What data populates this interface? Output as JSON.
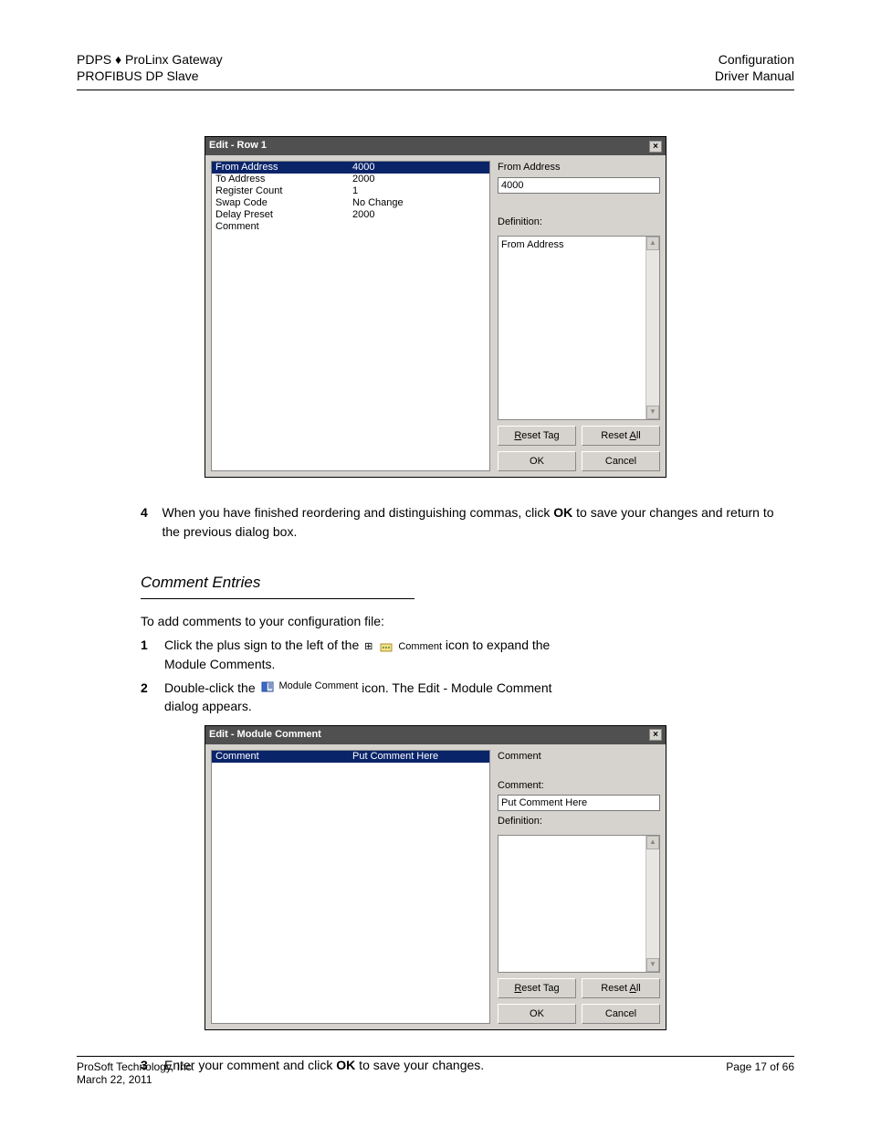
{
  "header": {
    "left_line1": "PDPS ♦ ProLinx Gateway",
    "left_line2": "PROFIBUS DP Slave",
    "right_line1": "Configuration",
    "right_line2": "Driver Manual"
  },
  "dialog1": {
    "title": "Edit - Row 1",
    "rows": [
      {
        "k": "From Address",
        "v": "4000",
        "sel": true
      },
      {
        "k": "To Address",
        "v": "2000",
        "sel": false
      },
      {
        "k": "Register Count",
        "v": "1",
        "sel": false
      },
      {
        "k": "Swap Code",
        "v": "No Change",
        "sel": false
      },
      {
        "k": "Delay Preset",
        "v": "2000",
        "sel": false
      },
      {
        "k": "Comment",
        "v": "",
        "sel": false
      }
    ],
    "field_label": "From Address",
    "field_value": "4000",
    "definition_label": "Definition:",
    "definition_text": "From Address",
    "reset_tag": "Reset Tag",
    "reset_all": "Reset All",
    "ok": "OK",
    "cancel": "Cancel"
  },
  "para_after_dlg1": {
    "n4": "4",
    "t4a": "When you have finished reordering and distinguishing commas, click ",
    "t4_bold": "OK",
    "t4b": " to save your changes and return to the previous dialog box."
  },
  "comment_section": {
    "title": "Comment Entries",
    "intro": "To add comments to your configuration file:",
    "n1": "1",
    "t1a": "Click the plus sign to the left of the ",
    "icon1_label": "Comment",
    "t1b": " icon to expand the",
    "t1c": "Module Comments.",
    "n2": "2",
    "t2a": "Double-click the ",
    "icon2_label": "Module Comment",
    "t2b": " icon. The Edit - Module Comment",
    "t2c": "dialog appears."
  },
  "dialog2": {
    "title": "Edit - Module Comment",
    "rows": [
      {
        "k": "Comment",
        "v": "Put Comment Here",
        "sel": true
      }
    ],
    "field_label": "Comment",
    "comment_label": "Comment:",
    "comment_value": "Put Comment Here",
    "definition_label": "Definition:",
    "definition_text": "",
    "reset_tag": "Reset Tag",
    "reset_all": "Reset All",
    "ok": "OK",
    "cancel": "Cancel"
  },
  "para_after_dlg2": {
    "n3": "3",
    "t3a": "Enter your comment and click ",
    "t3_bold": "OK",
    "t3b": " to save your changes."
  },
  "footer": {
    "left_line1": "ProSoft Technology, Inc.",
    "left_line2": "March 22, 2011",
    "right": "Page 17 of 66"
  },
  "icons": {
    "close": "×",
    "up": "▲",
    "down": "▼",
    "plus": "⊞"
  }
}
